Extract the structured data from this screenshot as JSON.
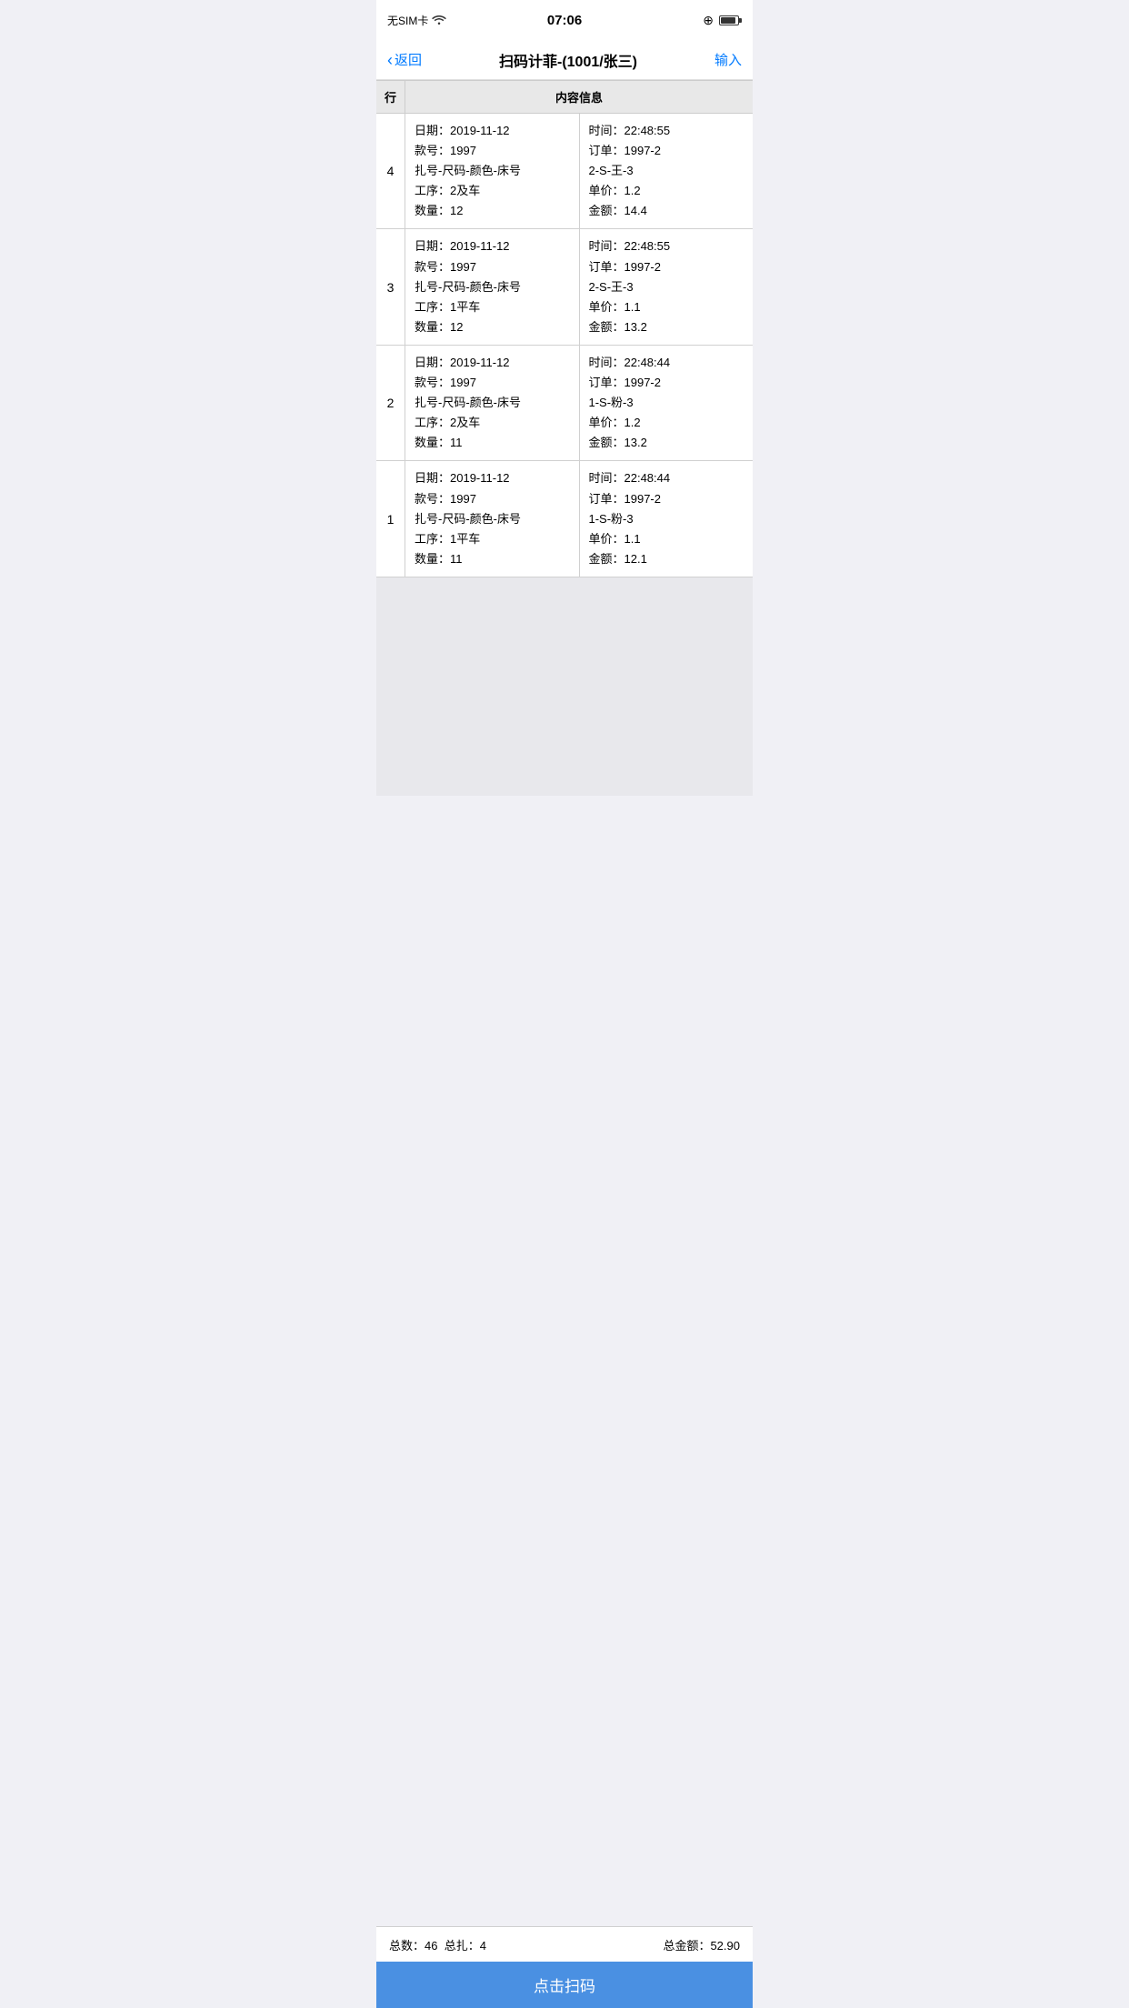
{
  "statusBar": {
    "carrier": "无SIM卡",
    "wifi": "wifi",
    "time": "07:06",
    "worldIcon": "⊕"
  },
  "navBar": {
    "backLabel": "返回",
    "title": "扫码计菲-(1001/张三)",
    "actionLabel": "输入"
  },
  "table": {
    "headerRow": "行",
    "headerContent": "内容信息",
    "rows": [
      {
        "rowNum": "4",
        "left": {
          "line1": "日期：2019-11-12",
          "line2": "款号：1997",
          "line3": "扎号-尺码-颜色-床号",
          "line4": "工序：2及车",
          "line5": "数量：12"
        },
        "right": {
          "line1": "时间：22:48:55",
          "line2": "订单：1997-2",
          "line3": "2-S-王-3",
          "line4": "单价：1.2",
          "line5": "金额：14.4"
        }
      },
      {
        "rowNum": "3",
        "left": {
          "line1": "日期：2019-11-12",
          "line2": "款号：1997",
          "line3": "扎号-尺码-颜色-床号",
          "line4": "工序：1平车",
          "line5": "数量：12"
        },
        "right": {
          "line1": "时间：22:48:55",
          "line2": "订单：1997-2",
          "line3": "2-S-王-3",
          "line4": "单价：1.1",
          "line5": "金额：13.2"
        }
      },
      {
        "rowNum": "2",
        "left": {
          "line1": "日期：2019-11-12",
          "line2": "款号：1997",
          "line3": "扎号-尺码-颜色-床号",
          "line4": "工序：2及车",
          "line5": "数量：11"
        },
        "right": {
          "line1": "时间：22:48:44",
          "line2": "订单：1997-2",
          "line3": "1-S-粉-3",
          "line4": "单价：1.2",
          "line5": "金额：13.2"
        }
      },
      {
        "rowNum": "1",
        "left": {
          "line1": "日期：2019-11-12",
          "line2": "款号：1997",
          "line3": "扎号-尺码-颜色-床号",
          "line4": "工序：1平车",
          "line5": "数量：11"
        },
        "right": {
          "line1": "时间：22:48:44",
          "line2": "订单：1997-2",
          "line3": "1-S-粉-3",
          "line4": "单价：1.1",
          "line5": "金额：12.1"
        }
      }
    ]
  },
  "footer": {
    "totalCount": "总数：46",
    "totalZha": "总扎：4",
    "totalAmount": "总金额：52.90"
  },
  "scanButton": {
    "label": "点击扫码"
  }
}
